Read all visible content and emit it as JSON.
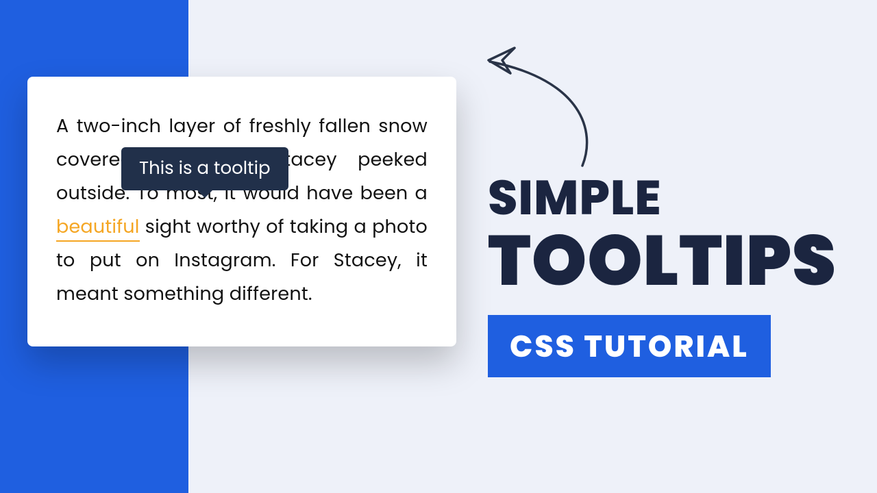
{
  "card": {
    "text_before": "A two-inch layer of freshly fallen snow covered the yard. Stacey peeked outside. To most, it would have been a ",
    "highlight_word": "beautiful",
    "text_after": " sight worthy of taking a photo to put on Instagram. For Stacey, it meant something different."
  },
  "tooltip": {
    "text": "This is a tooltip"
  },
  "headline": {
    "line1": "SIMPLE",
    "line2": "TOOLTIPS",
    "badge": "CSS TUTORIAL"
  }
}
